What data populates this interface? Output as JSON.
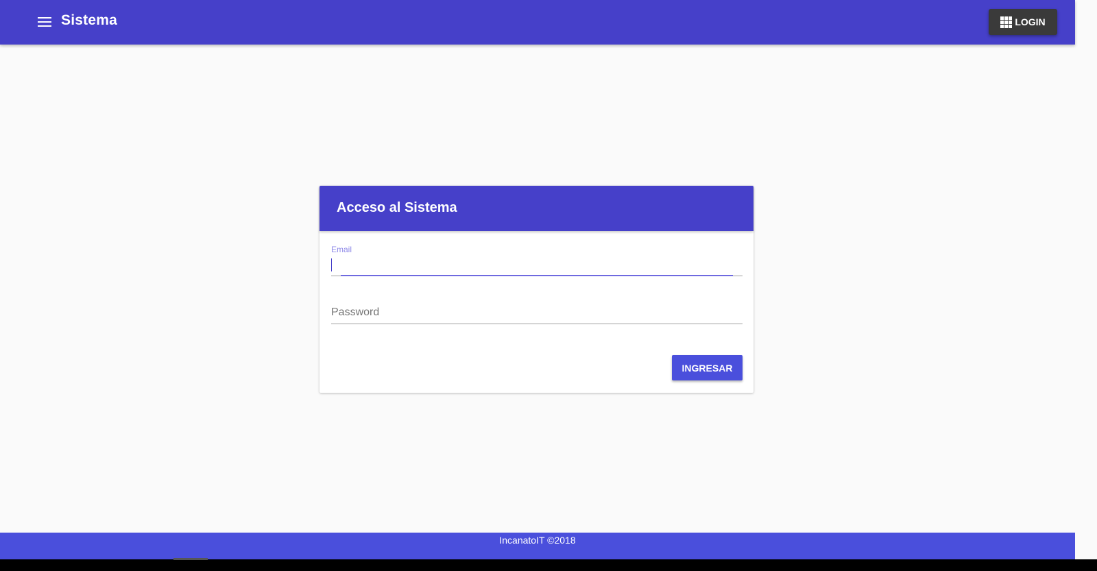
{
  "topbar": {
    "title": "Sistema",
    "menu_icon": "hamburger-menu-icon",
    "login_label": "LOGIN",
    "login_icon": "apps-grid-icon",
    "color": "#4640c9"
  },
  "login_card": {
    "title": "Acceso al Sistema",
    "email_label": "Email",
    "email_value": "",
    "password_placeholder": "Password",
    "submit_label": "INGRESAR",
    "accent": "#4a4fdc"
  },
  "footer": {
    "text": "IncanatoIT ©2018"
  }
}
